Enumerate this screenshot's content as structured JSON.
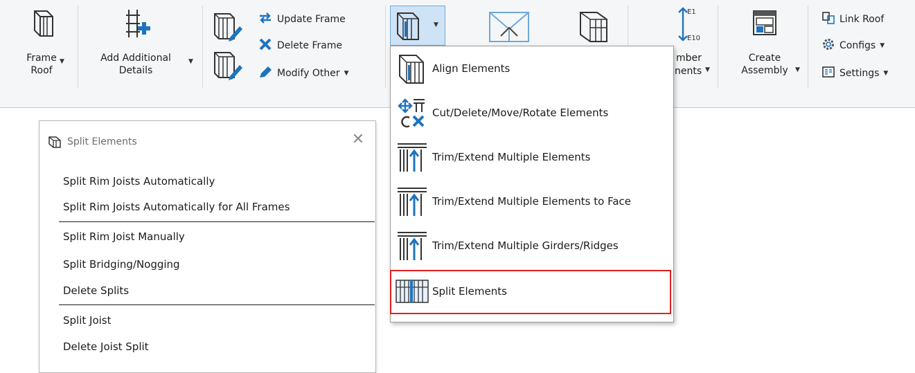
{
  "ribbon": {
    "frame_roof": {
      "line1": "Frame",
      "line2": "Roof",
      "icon": "frame-roof-icon"
    },
    "add_details": {
      "line1": "Add Additional",
      "line2": "Details",
      "icon": "add-details-icon"
    },
    "update_frame": "Update Frame",
    "delete_frame": "Delete Frame",
    "modify_other": "Modify Other",
    "member_elements": {
      "line1": "mber",
      "line2": "nents",
      "tag_top": "E1",
      "tag_bottom": "E10"
    },
    "create_assembly": {
      "line1": "Create",
      "line2": "Assembly"
    },
    "link_roof": "Link Roof",
    "configs": "Configs",
    "settings": "Settings"
  },
  "dropdown": {
    "items": [
      {
        "label": "Align Elements",
        "icon": "align-elements-icon"
      },
      {
        "label": "Cut/Delete/Move/Rotate Elements",
        "icon": "cut-move-rotate-icon"
      },
      {
        "label": "Trim/Extend Multiple Elements",
        "icon": "trim-extend-icon"
      },
      {
        "label": "Trim/Extend Multiple Elements to Face",
        "icon": "trim-extend-face-icon"
      },
      {
        "label": "Trim/Extend Multiple Girders/Ridges",
        "icon": "trim-extend-girders-icon"
      },
      {
        "label": "Split Elements",
        "icon": "split-elements-icon"
      }
    ],
    "highlight_color": "#e0201f"
  },
  "split_panel": {
    "title": "Split Elements",
    "items": [
      "Split Rim Joists Automatically",
      "Split Rim Joists Automatically for All Frames",
      "Split Rim Joist Manually",
      "Split Bridging/Nogging",
      "Delete Splits",
      "Split Joist",
      "Delete Joist Split"
    ]
  },
  "colors": {
    "accent_blue": "#1e73be",
    "ribbon_bg": "#f5f6f7"
  }
}
